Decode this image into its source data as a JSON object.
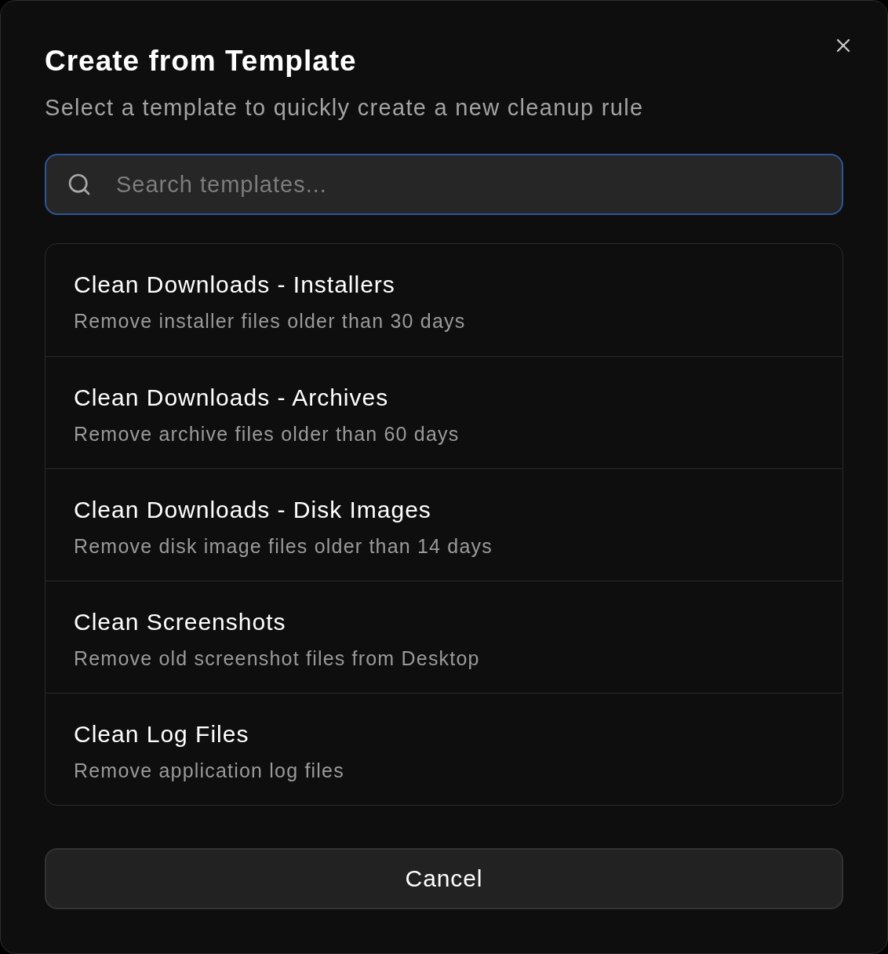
{
  "dialog": {
    "title": "Create from Template",
    "subtitle": "Select a template to quickly create a new cleanup rule"
  },
  "search": {
    "placeholder": "Search templates...",
    "focused": true
  },
  "templates": [
    {
      "name": "Clean Downloads - Installers",
      "description": "Remove installer files older than 30 days"
    },
    {
      "name": "Clean Downloads - Archives",
      "description": "Remove archive files older than 60 days"
    },
    {
      "name": "Clean Downloads - Disk Images",
      "description": "Remove disk image files older than 14 days"
    },
    {
      "name": "Clean Screenshots",
      "description": "Remove old screenshot files from Desktop"
    },
    {
      "name": "Clean Log Files",
      "description": "Remove application log files"
    }
  ],
  "buttons": [
    {
      "label": "Cancel"
    }
  ]
}
